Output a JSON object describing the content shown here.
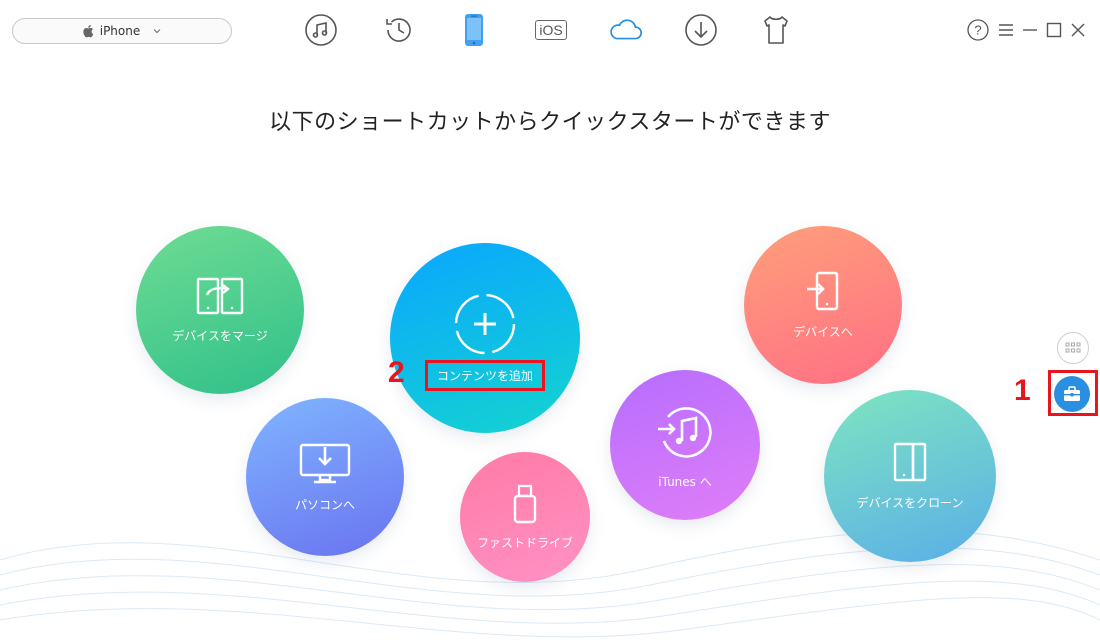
{
  "device": {
    "name": "iPhone"
  },
  "nav": [
    {
      "name": "music-icon"
    },
    {
      "name": "history-icon"
    },
    {
      "name": "iphone-device-icon",
      "active": true
    },
    {
      "name": "to-ios-icon",
      "label": "iOS"
    },
    {
      "name": "icloud-icon"
    },
    {
      "name": "download-icon"
    },
    {
      "name": "tshirt-icon"
    }
  ],
  "window": {
    "help": "?"
  },
  "headline": "以下のショートカットからクイックスタートができます",
  "shortcuts": {
    "merge": "デバイスをマージ",
    "add": "コンテンツを追加",
    "pc": "パソコンへ",
    "flash": "ファストドライブ",
    "itunes": "iTunes へ",
    "todevice": "デバイスへ",
    "clone": "デバイスをクローン"
  },
  "annotations": {
    "step1": "1",
    "step2": "2"
  },
  "colors": {
    "accent": "#2a8fe0",
    "highlight": "#e8141e",
    "nav_active": "#2a8fe0"
  }
}
